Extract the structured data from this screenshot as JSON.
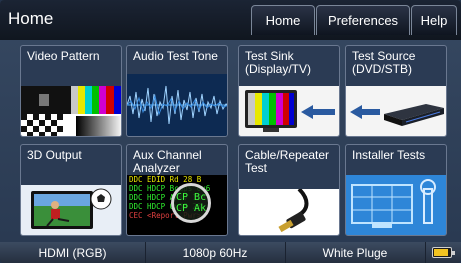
{
  "header": {
    "title": "Home"
  },
  "nav": {
    "home": "Home",
    "preferences": "Preferences",
    "help": "Help"
  },
  "tiles": {
    "video_pattern": "Video Pattern",
    "audio_test_tone": "Audio Test Tone",
    "test_sink": "Test Sink\n(Display/TV)",
    "test_source": "Test Source\n(DVD/STB)",
    "output_3d": "3D Output",
    "aux_channel": "Aux Channel\nAnalyzer",
    "cable_repeater": "Cable/Repeater\nTest",
    "installer_tests": "Installer Tests"
  },
  "aux_text": {
    "line1": "DDC EDID Rd 28 B",
    "line2": "DDC HDCP Bcaps 0x6",
    "line3": "DDC HDCP Aksv 128",
    "line4": "DDC HDCP 0x58 28",
    "line5": "CEC <Report Pwr>",
    "magnifier1": "CP Bc",
    "magnifier2": "CP Ak"
  },
  "status": {
    "interface": "HDMI (RGB)",
    "resolution": "1080p 60Hz",
    "pattern": "White Pluge"
  },
  "colors": {
    "battery": "#f2c321",
    "accent": "#6a7890"
  }
}
